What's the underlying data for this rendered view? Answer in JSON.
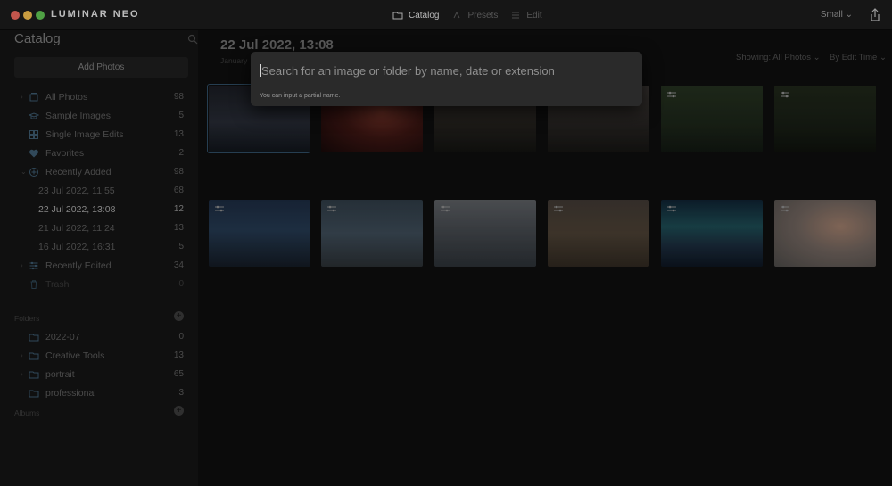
{
  "app": {
    "logo_text": "LUMINAR",
    "logo_suffix": "NEO"
  },
  "topnav": [
    {
      "label": "Catalog",
      "active": true,
      "icon": "folder-icon"
    },
    {
      "label": "Presets",
      "active": false,
      "icon": "presets-icon"
    },
    {
      "label": "Edit",
      "active": false,
      "icon": "sliders-icon"
    }
  ],
  "size_select": "Small",
  "sidebar": {
    "title": "Catalog",
    "add_photos": "Add Photos",
    "items": [
      {
        "label": "All Photos",
        "count": "98",
        "icon": "all-photos-icon"
      },
      {
        "label": "Sample Images",
        "count": "5",
        "icon": "graduation-cap-icon"
      },
      {
        "label": "Single Image Edits",
        "count": "13",
        "icon": "grid-icon"
      },
      {
        "label": "Favorites",
        "count": "2",
        "icon": "heart-icon"
      },
      {
        "label": "Recently Added",
        "count": "98",
        "icon": "plus-circle-icon"
      },
      {
        "label": "23 Jul 2022, 11:55",
        "count": "68"
      },
      {
        "label": "22 Jul 2022, 13:08",
        "count": "12"
      },
      {
        "label": "21 Jul 2022, 11:24",
        "count": "13"
      },
      {
        "label": "16 Jul 2022, 16:31",
        "count": "5"
      },
      {
        "label": "Recently Edited",
        "count": "34",
        "icon": "sliders-icon"
      },
      {
        "label": "Trash",
        "count": "0",
        "icon": "trash-icon"
      }
    ],
    "folders_title": "Folders",
    "folders": [
      {
        "label": "2022-07",
        "count": "0"
      },
      {
        "label": "Creative Tools",
        "count": "13"
      },
      {
        "label": "portrait",
        "count": "65"
      },
      {
        "label": "professional",
        "count": "3"
      }
    ],
    "albums_title": "Albums"
  },
  "main": {
    "title": "22 Jul 2022, 13:08",
    "subtitle": "January",
    "showing": "Showing: All Photos",
    "sort": "By Edit Time"
  },
  "search": {
    "placeholder": "Search for an image or folder by name, date or extension",
    "hint": "You can input a partial name."
  }
}
